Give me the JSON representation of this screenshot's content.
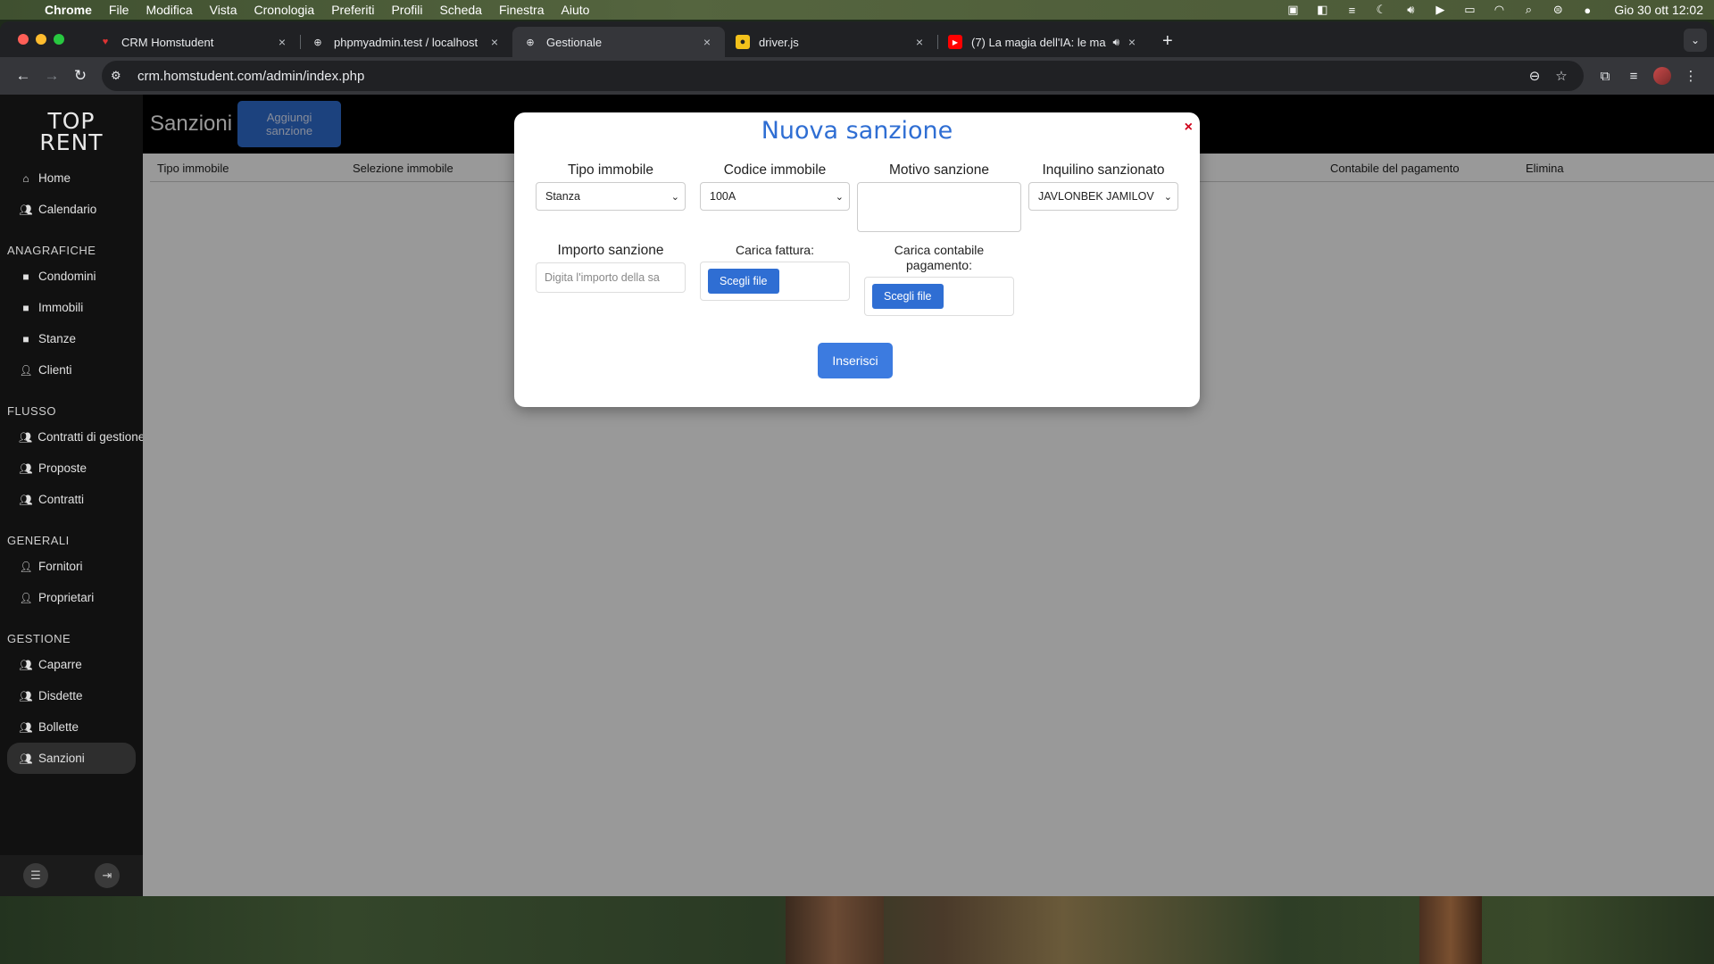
{
  "menubar": {
    "app": "Chrome",
    "items": [
      "File",
      "Modifica",
      "Vista",
      "Cronologia",
      "Preferiti",
      "Profili",
      "Scheda",
      "Finestra",
      "Aiuto"
    ],
    "clock": "Gio 30 ott  12:02"
  },
  "browser": {
    "tabs": [
      {
        "title": "CRM Homstudent",
        "close": "×"
      },
      {
        "title": "phpmyadmin.test / localhost",
        "close": "×"
      },
      {
        "title": "Gestionale",
        "close": "×"
      },
      {
        "title": "driver.js",
        "close": "×"
      },
      {
        "title": "(7) La magia dell'IA: le ma",
        "close": "×"
      }
    ],
    "new_tab": "+",
    "url": "crm.homstudent.com/admin/index.php"
  },
  "sidebar": {
    "logo_line1": "TOP",
    "logo_line2": "RENT",
    "top_items": [
      {
        "label": "Home",
        "icon": "home-icon"
      },
      {
        "label": "Calendario",
        "icon": "people-icon"
      }
    ],
    "sections": [
      {
        "title": "ANAGRAFICHE",
        "items": [
          "Condomini",
          "Immobili",
          "Stanze",
          "Clienti"
        ]
      },
      {
        "title": "FLUSSO",
        "items": [
          "Contratti di gestione",
          "Proposte",
          "Contratti"
        ]
      },
      {
        "title": "GENERALI",
        "items": [
          "Fornitori",
          "Proprietari"
        ]
      },
      {
        "title": "GESTIONE",
        "items": [
          "Caparre",
          "Disdette",
          "Bollette",
          "Sanzioni"
        ]
      }
    ]
  },
  "main": {
    "title": "Sanzioni",
    "add_button": "Aggiungi sanzione",
    "columns": {
      "tipo": "Tipo immobile",
      "selezione": "Selezione immobile",
      "contabile": "Contabile del pagamento",
      "elimina": "Elimina"
    }
  },
  "modal": {
    "title": "Nuova sanzione",
    "close": "×",
    "tipo_label": "Tipo immobile",
    "tipo_value": "Stanza",
    "codice_label": "Codice immobile",
    "codice_value": "100A",
    "motivo_label": "Motivo sanzione",
    "inquilino_label": "Inquilino sanzionato",
    "inquilino_value": "JAVLONBEK JAMILOV",
    "importo_label": "Importo sanzione",
    "importo_placeholder": "Digita l'importo della sa",
    "fattura_label": "Carica fattura:",
    "contabile_label_1": "Carica contabile",
    "contabile_label_2": "pagamento:",
    "choose_file": "Scegli file",
    "submit": "Inserisci"
  },
  "colors": {
    "accent": "#2f6ed3",
    "close": "#d0021b",
    "sidebar_bg": "#111111"
  }
}
